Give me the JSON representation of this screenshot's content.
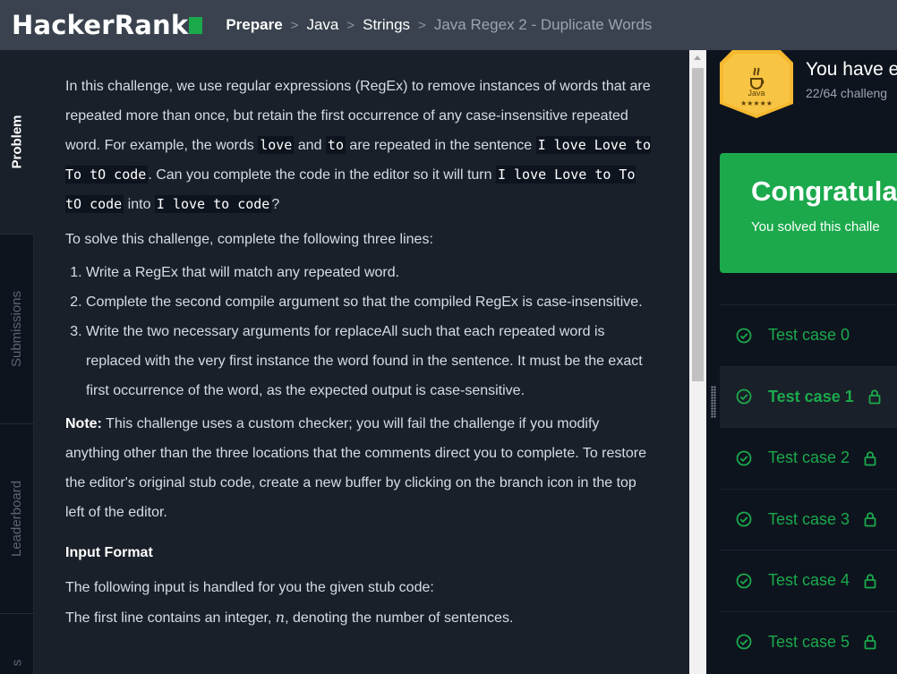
{
  "header": {
    "logo": "HackerRank",
    "breadcrumbs": [
      {
        "label": "Prepare"
      },
      {
        "label": "Java"
      },
      {
        "label": "Strings"
      },
      {
        "label": "Java Regex 2 - Duplicate Words"
      }
    ]
  },
  "sidetabs": {
    "problem": "Problem",
    "submissions": "Submissions",
    "leaderboard": "Leaderboard",
    "discussions": "s"
  },
  "problem": {
    "p1_a": "In this challenge, we use regular expressions (RegEx) to remove instances of words that are repeated more than once, but retain the first occurrence of any case-insensitive repeated word. For example, the words ",
    "code_love": "love",
    "p1_and": " and ",
    "code_to": "to",
    "p1_b": " are repeated in the sentence ",
    "code_sentence": "I love Love to To tO code",
    "p1_c": ". Can you complete the code in the editor so it will turn ",
    "code_sentence2": "I love Love to To tO code",
    "p1_into": " into ",
    "code_result": "I love to code",
    "p1_q": "?",
    "p2": "To solve this challenge, complete the following three lines:",
    "steps": [
      "Write a RegEx that will match any repeated word.",
      "Complete the second compile argument so that the compiled RegEx is case-insensitive.",
      "Write the two necessary arguments for replaceAll such that each repeated word is replaced with the very first instance the word found in the sentence. It must be the exact first occurrence of the word, as the expected output is case-sensitive."
    ],
    "note_label": "Note:",
    "note_text": " This challenge uses a custom checker; you will fail the challenge if you modify anything other than the three locations that the comments direct you to complete. To restore the editor's original stub code, create a new buffer by clicking on the branch icon in the top left of the editor.",
    "input_heading": "Input Format",
    "input_p1": "The following input is handled for you the given stub code:",
    "input_p2_a": "The first line contains an integer, ",
    "input_var": "n",
    "input_p2_b": ", denoting the number of sentences."
  },
  "right": {
    "badge_label": "Java",
    "badge_stars": "★★★★★",
    "badge_title": "You have e",
    "badge_progress": "22/64 challeng",
    "congrats_title": "Congratula",
    "congrats_text": "You solved this challe",
    "tests": [
      {
        "label": "Test case 0",
        "locked": false,
        "selected": false
      },
      {
        "label": "Test case 1",
        "locked": true,
        "selected": true
      },
      {
        "label": "Test case 2",
        "locked": true,
        "selected": false
      },
      {
        "label": "Test case 3",
        "locked": true,
        "selected": false
      },
      {
        "label": "Test case 4",
        "locked": true,
        "selected": false
      },
      {
        "label": "Test case 5",
        "locked": true,
        "selected": false
      }
    ]
  },
  "colors": {
    "brand_green": "#1ba94c",
    "header_bg": "#39424e",
    "panel_bg": "#1a2029",
    "page_bg": "#0e141e",
    "badge_gold": "#f5b82e"
  }
}
